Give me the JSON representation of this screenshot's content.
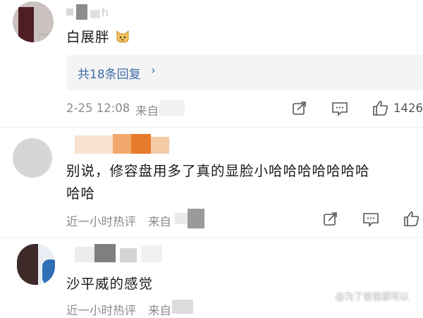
{
  "comments": [
    {
      "name_fragment": "h",
      "text": "白展胖",
      "emoji": "cat-face",
      "reply_link": "共18条回复",
      "time": "2-25 12:08",
      "source": "来自",
      "like_count": "1426"
    },
    {
      "text_line1": "别说，修容盘用多了真的显脸小哈哈哈哈哈哈哈",
      "text_line2": "哈哈",
      "time": "近一小时热评",
      "source": "来自"
    },
    {
      "text": "沙平威的感觉",
      "time": "近一小时热评",
      "source": "来自"
    }
  ],
  "watermark": "@为了爸爸都可以",
  "icons": [
    "share-icon",
    "comment-icon",
    "like-icon"
  ],
  "colors": {
    "link": "#3f6da8",
    "meta": "#8a8a8a"
  }
}
